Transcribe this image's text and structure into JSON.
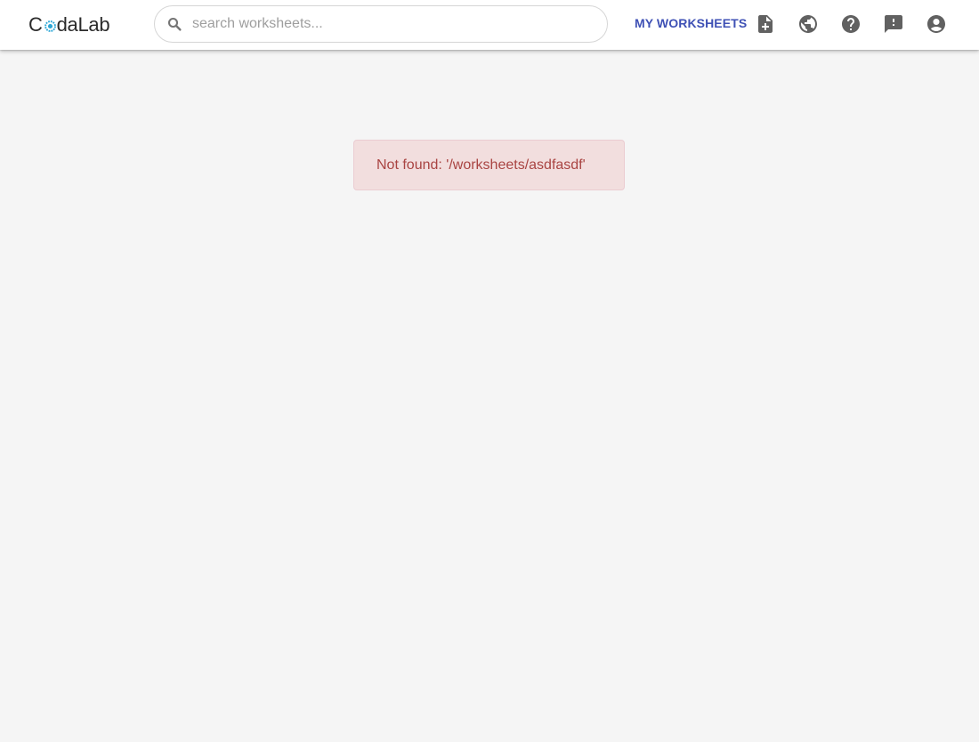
{
  "header": {
    "logo_text_prefix": "C",
    "logo_text_suffix": "daLab",
    "logo_alt": "CodaLab",
    "search": {
      "placeholder": "search worksheets...",
      "value": ""
    },
    "nav_link_label": "MY WORKSHEETS",
    "icons": [
      "new-worksheet-icon",
      "gallery-globe-icon",
      "help-icon",
      "feedback-icon",
      "account-icon"
    ]
  },
  "main": {
    "error_message": "Not found: '/worksheets/asdfasdf'"
  },
  "colors": {
    "background": "#f5f5f5",
    "topbar": "#ffffff",
    "accent": "#3f51b5",
    "icon": "#616161",
    "alert_bg": "#f2dede",
    "alert_border": "#ebccd1",
    "alert_text": "#a94442",
    "logo_blue": "#2aa6d6"
  }
}
